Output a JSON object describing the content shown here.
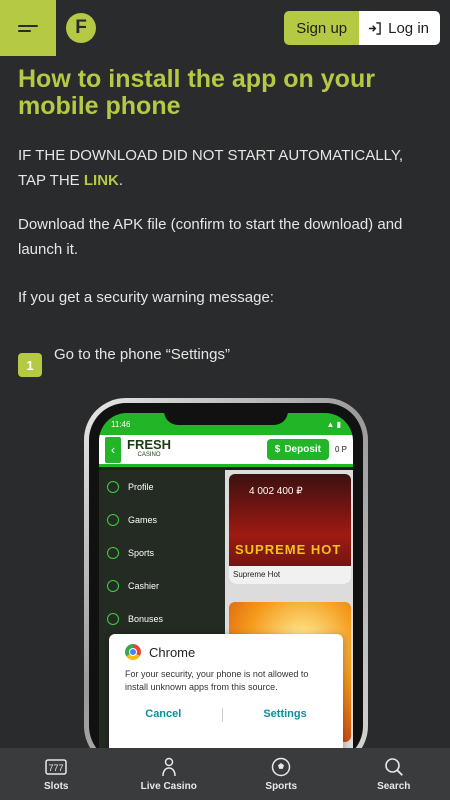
{
  "header": {
    "signup_label": "Sign up",
    "login_label": "Log in",
    "logo_letter": "F"
  },
  "content": {
    "title": "How to install the app on your mobile phone",
    "p1_text": "IF THE DOWNLOAD DID NOT START AUTOMATICALLY, TAP THE ",
    "p1_link": "LINK",
    "p1_end": ".",
    "p2": "Download the APK file (confirm to start the download) and launch it.",
    "p3": "If you get a security warning message:",
    "step_number": "1",
    "step_text": "Go to the phone “Settings”"
  },
  "phone": {
    "status_time": "11:46",
    "app_brand": "FRESH",
    "app_brand_sub": "CASINO",
    "deposit_label": "Deposit",
    "balance": "0 P",
    "menu_items": [
      "Profile",
      "Games",
      "Sports",
      "Cashier",
      "Bonuses"
    ],
    "tile_amount": "4 002 400 ₽",
    "tile_game_title": "SUPREME HOT",
    "tile_caption": "Supreme Hot",
    "dialog_title": "Chrome",
    "dialog_body": "For your security, your phone is not allowed to install unknown apps from this source.",
    "dialog_cancel": "Cancel",
    "dialog_settings": "Settings"
  },
  "bottom_nav": {
    "slots": "Slots",
    "live_casino": "Live Casino",
    "sports": "Sports",
    "search": "Search"
  },
  "colors": {
    "accent": "#b5c944",
    "background": "#2a2b2c",
    "phone_green": "#21b527"
  }
}
